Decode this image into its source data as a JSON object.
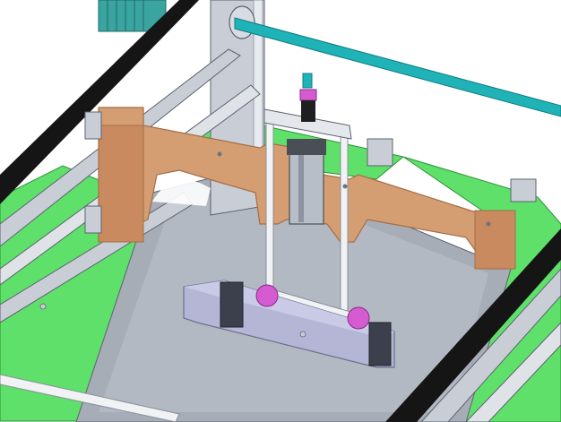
{
  "scene": {
    "kind": "cad-render",
    "subject": "gantry-pick-and-place-mechanism",
    "colors": {
      "background": "#ffffff",
      "frame_green": "#5fe06a",
      "frame_green_dark": "#2f8f3a",
      "bed_gray": "#a7adb7",
      "rail_silver": "#c9ced6",
      "rail_dark": "#5b6370",
      "bracket_orange": "#d49d72",
      "bracket_orange_dark": "#a46e45",
      "shaft_cyan": "#1fb3b8",
      "motor_teal": "#3aa4a0",
      "cylinder_gray": "#b8bec8",
      "cylinder_dark": "#4a4f57",
      "clamp_block": "#b5b6d6",
      "clamp_dark": "#6b6f8e",
      "accent_magenta": "#d55bd1",
      "belt_black": "#151515",
      "post_white": "#f1f2f4"
    }
  }
}
